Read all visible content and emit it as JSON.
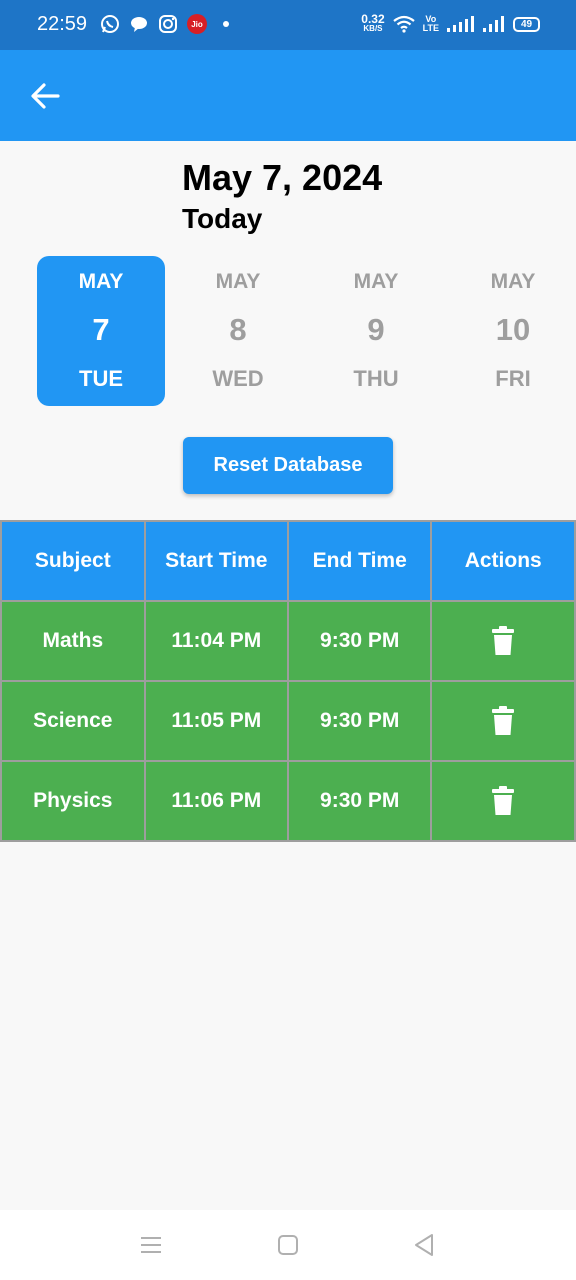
{
  "status_bar": {
    "time": "22:59",
    "net_speed_value": "0.32",
    "net_speed_unit": "KB/S",
    "volte_top": "Vo",
    "volte_bottom": "LTE",
    "battery": "49",
    "jio_label": "Jio"
  },
  "app_bar": {
    "back_icon": "arrow-left-icon"
  },
  "header": {
    "date": "May 7, 2024",
    "subtitle": "Today"
  },
  "days": [
    {
      "month": "MAY",
      "day": "7",
      "weekday": "TUE",
      "selected": true
    },
    {
      "month": "MAY",
      "day": "8",
      "weekday": "WED",
      "selected": false
    },
    {
      "month": "MAY",
      "day": "9",
      "weekday": "THU",
      "selected": false
    },
    {
      "month": "MAY",
      "day": "10",
      "weekday": "FRI",
      "selected": false
    }
  ],
  "reset_button": {
    "label": "Reset Database"
  },
  "table": {
    "headers": [
      "Subject",
      "Start Time",
      "End Time",
      "Actions"
    ],
    "rows": [
      {
        "subject": "Maths",
        "start": "11:04 PM",
        "end": "9:30 PM"
      },
      {
        "subject": "Science",
        "start": "11:05 PM",
        "end": "9:30 PM"
      },
      {
        "subject": "Physics",
        "start": "11:06 PM",
        "end": "9:30 PM"
      }
    ]
  },
  "colors": {
    "primary": "#2196f3",
    "status_bar": "#1e75c7",
    "row_green": "#4caf50",
    "inactive_text": "#9e9e9e"
  }
}
